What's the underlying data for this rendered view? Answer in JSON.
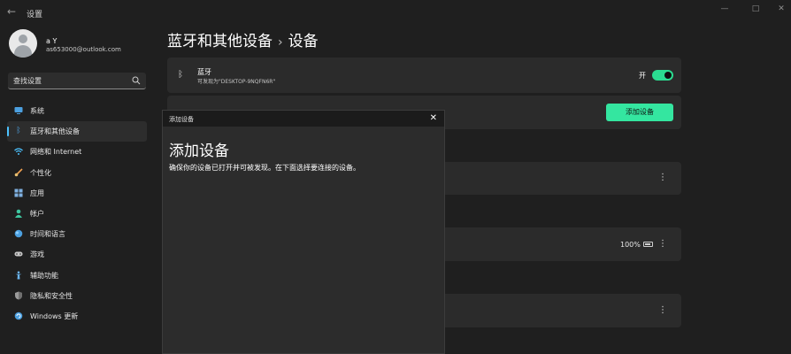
{
  "window": {
    "title": "设置"
  },
  "profile": {
    "name": "a Y",
    "email": "as653000@outlook.com"
  },
  "search": {
    "text": "查找设置"
  },
  "nav": {
    "items": [
      {
        "label": "系统",
        "icon": "monitor-icon",
        "color": "#4ca0e0"
      },
      {
        "label": "蓝牙和其他设备",
        "icon": "bluetooth-icon",
        "color": "#4ca0e0"
      },
      {
        "label": "网络和 Internet",
        "icon": "wifi-icon",
        "color": "#4cc2ff"
      },
      {
        "label": "个性化",
        "icon": "brush-icon",
        "color": "#f0a050"
      },
      {
        "label": "应用",
        "icon": "apps-icon",
        "color": "#7fb0e0"
      },
      {
        "label": "帐户",
        "icon": "person-icon",
        "color": "#3ec6a0"
      },
      {
        "label": "时间和语言",
        "icon": "globe-icon",
        "color": "#4ca0e0"
      },
      {
        "label": "游戏",
        "icon": "gamepad-icon",
        "color": "#c8c8c8"
      },
      {
        "label": "辅助功能",
        "icon": "accessibility-icon",
        "color": "#6ab4f0"
      },
      {
        "label": "隐私和安全性",
        "icon": "shield-icon",
        "color": "#9a9a9a"
      },
      {
        "label": "Windows 更新",
        "icon": "update-icon",
        "color": "#4ca0e0"
      }
    ],
    "active_index": 1
  },
  "main": {
    "breadcrumb_parent": "蓝牙和其他设备",
    "breadcrumb_current": "设备",
    "bluetooth": {
      "title": "蓝牙",
      "subtitle": "可发现为\"DESKTOP-9NQFN6R\"",
      "toggle_label": "开",
      "toggle_on": true
    },
    "add_device_label": "添加设备",
    "battery_text": "100%"
  },
  "dialog": {
    "title": "添加设备",
    "heading": "添加设备",
    "description": "确保你的设备已打开并可被发现。在下面选择要连接的设备。"
  },
  "colors": {
    "accent": "#34e6a0",
    "toggle": "#2bdd91",
    "background": "#1f1f1f",
    "card": "#2b2b2b"
  }
}
